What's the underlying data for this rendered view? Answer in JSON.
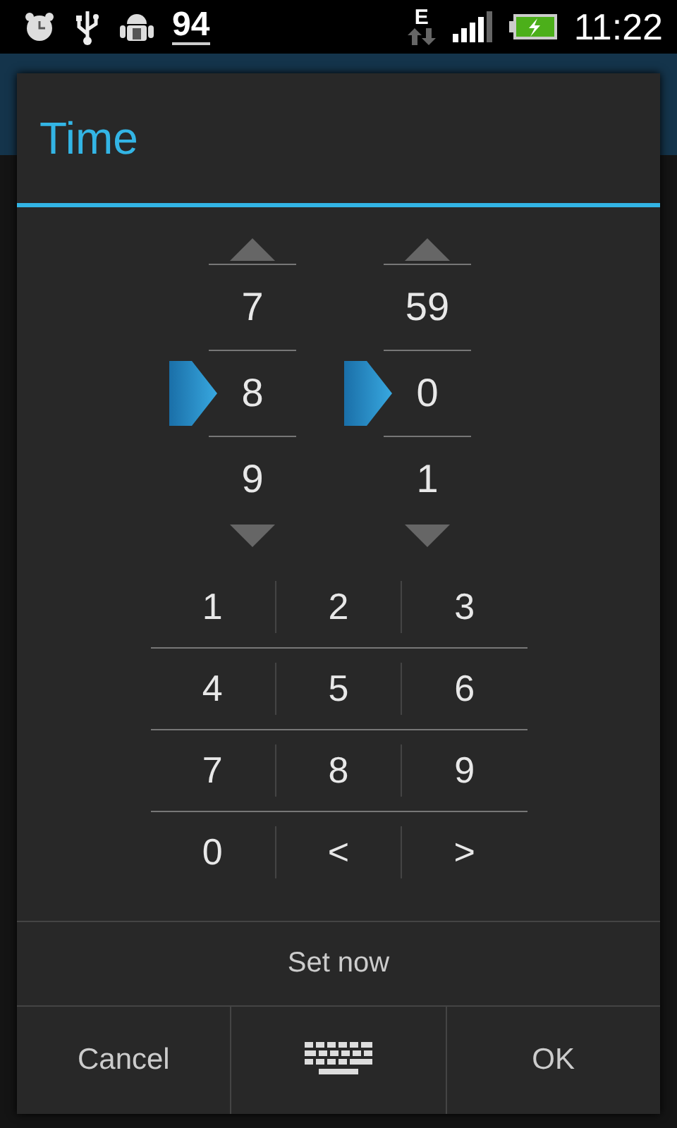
{
  "status_bar": {
    "battery_percent": "94",
    "network_type": "E",
    "time": "11:22"
  },
  "dialog": {
    "title": "Time",
    "pickers": [
      {
        "items": [
          {
            "value": "7",
            "selected": false
          },
          {
            "value": "8",
            "selected": true
          },
          {
            "value": "9",
            "selected": false
          }
        ]
      },
      {
        "items": [
          {
            "value": "59",
            "selected": false
          },
          {
            "value": "0",
            "selected": true
          },
          {
            "value": "1",
            "selected": false
          }
        ]
      }
    ],
    "keypad": [
      [
        "1",
        "2",
        "3"
      ],
      [
        "4",
        "5",
        "6"
      ],
      [
        "7",
        "8",
        "9"
      ],
      [
        "0",
        "<",
        ">"
      ]
    ],
    "set_now": "Set now",
    "buttons": [
      {
        "kind": "text",
        "label": "Cancel"
      },
      {
        "kind": "keyboard"
      },
      {
        "kind": "text",
        "label": "OK"
      }
    ]
  }
}
